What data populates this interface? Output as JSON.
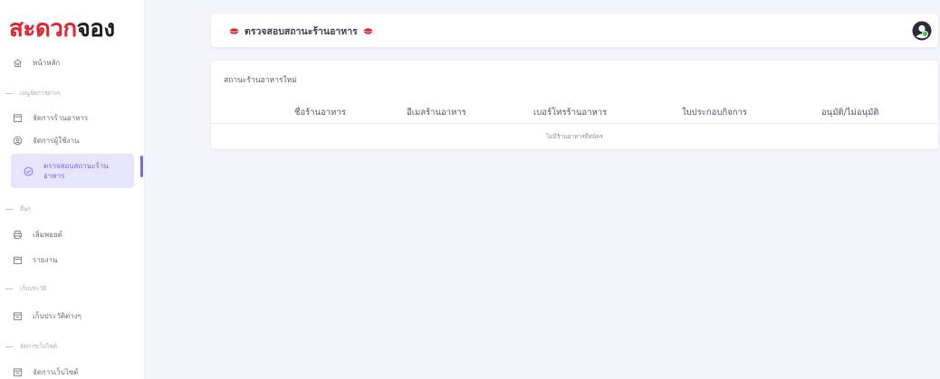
{
  "logo": {
    "part1": "สะดวก",
    "part2": "จอง"
  },
  "sidebar": {
    "home": "หน้าหลัก",
    "section_manage": "เมนูจัดการต่างๆ",
    "manage_restaurants": "จัดการร้านอาหาร",
    "manage_users": "จัดการผู้ใช้งาน",
    "verify_status": "ตรวจสอบสถานะร้านอาหาร",
    "section_other": "อื่นๆ",
    "printer": "เลิ่มพอยต์",
    "reports": "รายงาน",
    "section_history": "เก็บประวัติ",
    "history": "เก็บประวัติต่างๆ",
    "section_website": "จัดการเว็บไซต์",
    "website": "จัดการเว็บไซต์"
  },
  "header": {
    "title": "ตรวจสอบสถานะร้านอาหาร"
  },
  "card": {
    "title": "สถานะร้านอาหารใหม่",
    "columns": [
      "ชื่อร้านอาหาร",
      "อีเมลร้านอาหาร",
      "เบอร์โทรร้านอาหาร",
      "ใบประกอบกิจการ",
      "อนุมัติ/ไม่อนุมัติ"
    ],
    "empty": "ไม่มีร้านอาหารที่สมัคร"
  },
  "colors": {
    "accent": "#7568e6",
    "brand_red": "#e0252f",
    "online": "#4cc43a"
  }
}
